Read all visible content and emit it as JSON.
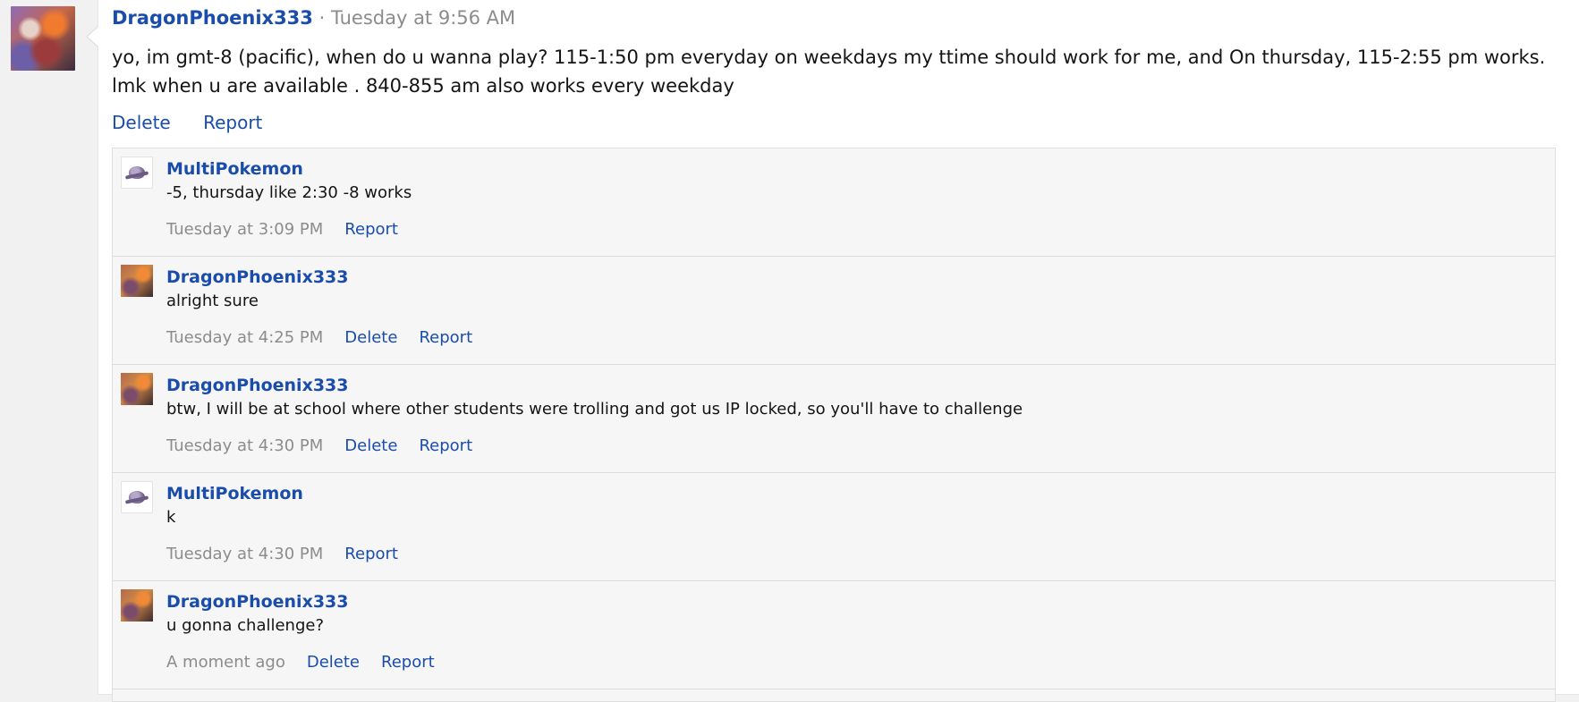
{
  "post": {
    "author": "DragonPhoenix333",
    "separator": " · ",
    "timestamp": "Tuesday at 9:56 AM",
    "body": "yo, im gmt-8 (pacific), when do u wanna play? 115-1:50 pm everyday on weekdays my ttime should work for me, and On thursday, 115-2:55 pm works. lmk when u are available . 840-855 am also works every weekday",
    "actions": {
      "delete": "Delete",
      "report": "Report"
    }
  },
  "comments": [
    {
      "author": "MultiPokemon",
      "avatar": "pokemon-avatar",
      "text": "-5, thursday like 2:30 -8 works",
      "time": "Tuesday at 3:09 PM",
      "delete": "",
      "report": "Report"
    },
    {
      "author": "DragonPhoenix333",
      "avatar": "dragon-avatar",
      "text": "alright sure",
      "time": "Tuesday at 4:25 PM",
      "delete": "Delete",
      "report": "Report"
    },
    {
      "author": "DragonPhoenix333",
      "avatar": "dragon-avatar",
      "text": "btw, I will be at school where other students were trolling and got us IP locked, so you'll have to challenge",
      "time": "Tuesday at 4:30 PM",
      "delete": "Delete",
      "report": "Report"
    },
    {
      "author": "MultiPokemon",
      "avatar": "pokemon-avatar",
      "text": "k",
      "time": "Tuesday at 4:30 PM",
      "delete": "",
      "report": "Report"
    },
    {
      "author": "DragonPhoenix333",
      "avatar": "dragon-avatar",
      "text": "u gonna challenge?",
      "time": "A moment ago",
      "delete": "Delete",
      "report": "Report"
    }
  ]
}
